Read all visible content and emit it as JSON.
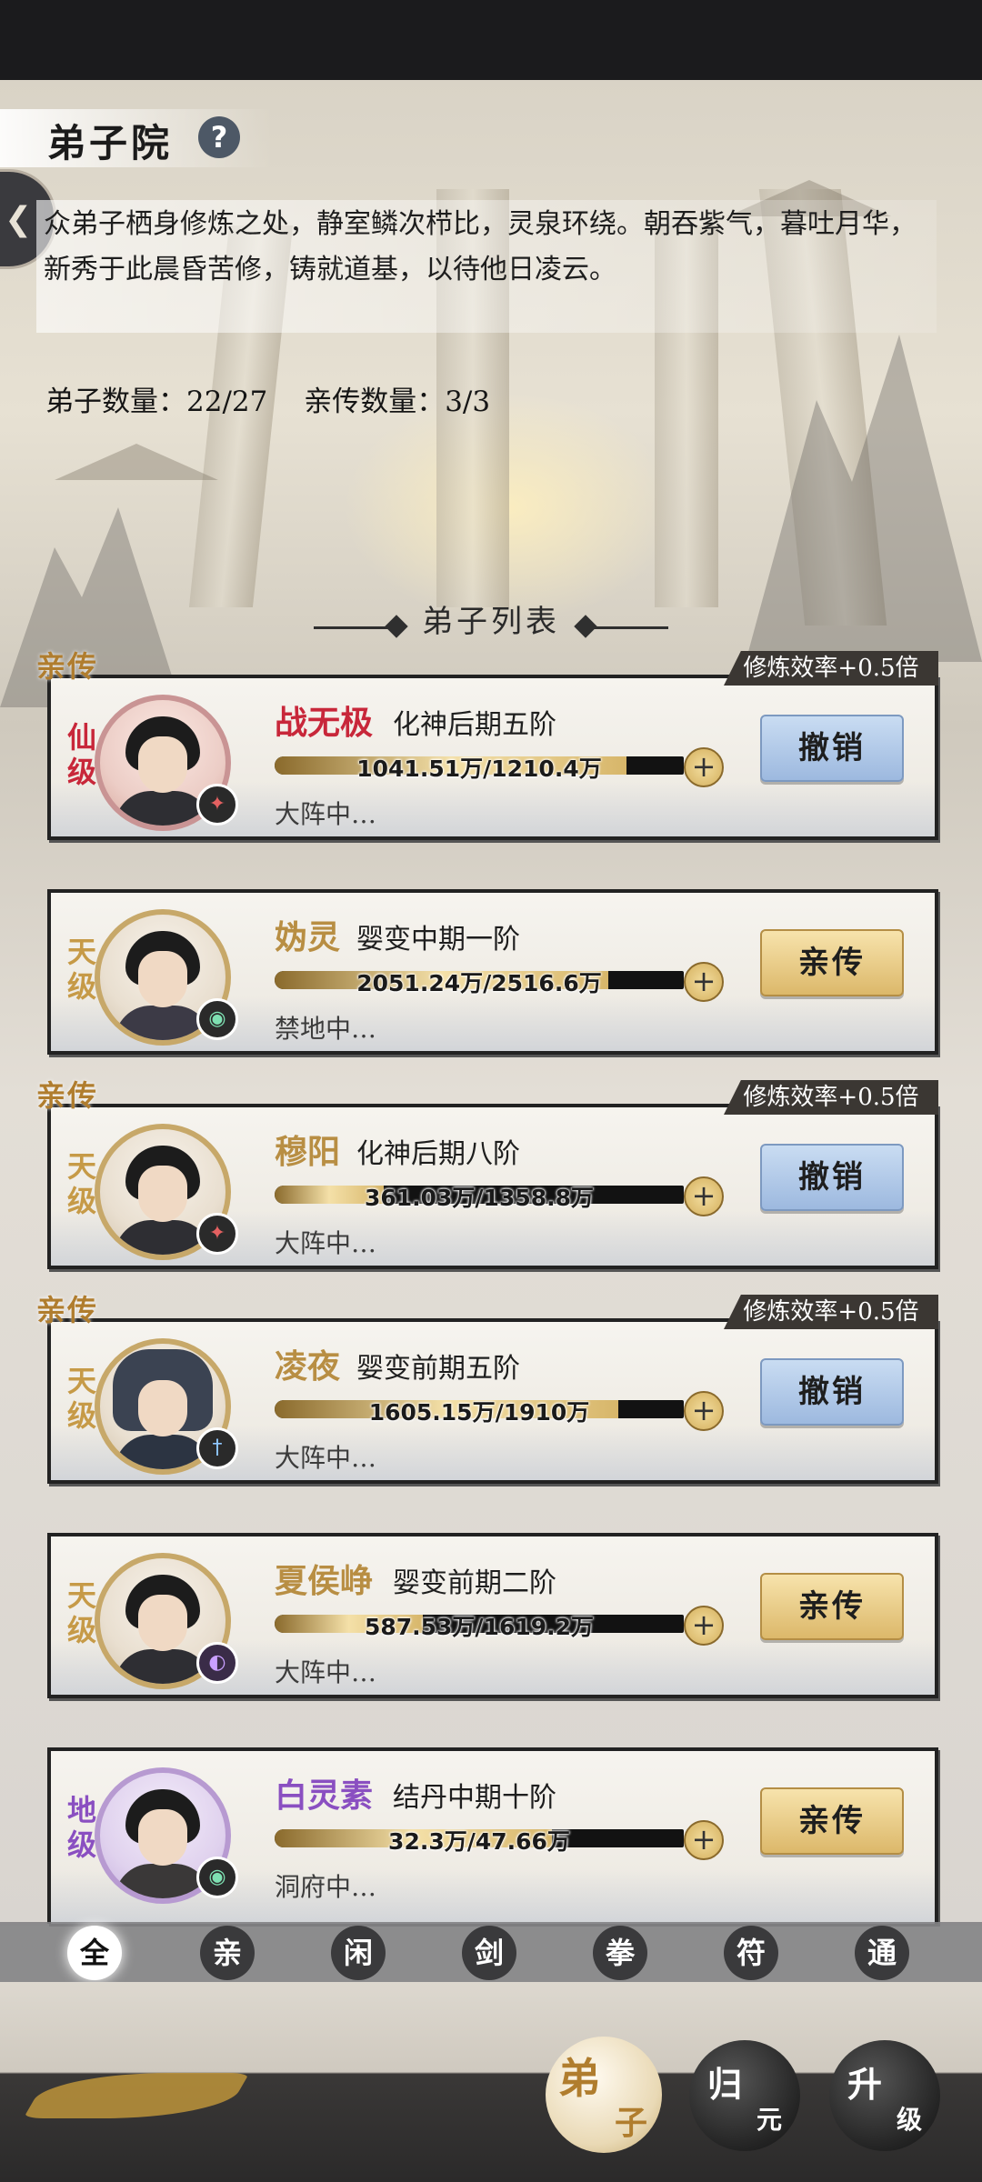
{
  "header": {
    "title": "弟子院",
    "help_icon": "?",
    "back_icon": "back-chevron"
  },
  "intro": {
    "text": "众弟子栖身修炼之处，静室鳞次栉比，灵泉环绕。朝吞紫气，暮吐月华，新秀于此晨昏苦修，铸就道基，以待他日凌云。"
  },
  "counts": {
    "disciples": "弟子数量：22/27",
    "inner": "亲传数量：3/3"
  },
  "list": {
    "title": "弟子列表"
  },
  "disciples": [
    {
      "name": "战无极",
      "realm": "化神后期五阶",
      "grade": "仙级",
      "progress": "1041.51万/1210.4万",
      "progress_ratio": 0.86,
      "status": "大阵中…",
      "action": "撤销",
      "inner": true,
      "inner_tag": "亲传",
      "bonus": "修炼效率+0.5倍",
      "element_icon": "fire-icon"
    },
    {
      "name": "妫灵",
      "realm": "婴变中期一阶",
      "grade": "天级",
      "progress": "2051.24万/2516.6万",
      "progress_ratio": 0.815,
      "status": "禁地中…",
      "action": "亲传",
      "inner": false,
      "element_icon": "wind-icon"
    },
    {
      "name": "穆阳",
      "realm": "化神后期八阶",
      "grade": "天级",
      "progress": "361.03万/1358.8万",
      "progress_ratio": 0.266,
      "status": "大阵中…",
      "action": "撤销",
      "inner": true,
      "inner_tag": "亲传",
      "bonus": "修炼效率+0.5倍",
      "element_icon": "fire-icon"
    },
    {
      "name": "凌夜",
      "realm": "婴变前期五阶",
      "grade": "天级",
      "progress": "1605.15万/1910万",
      "progress_ratio": 0.84,
      "status": "大阵中…",
      "action": "撤销",
      "inner": true,
      "inner_tag": "亲传",
      "bonus": "修炼效率+0.5倍",
      "element_icon": "sword-icon"
    },
    {
      "name": "夏侯峥",
      "realm": "婴变前期二阶",
      "grade": "天级",
      "progress": "587.53万/1619.2万",
      "progress_ratio": 0.363,
      "status": "大阵中…",
      "action": "亲传",
      "inner": false,
      "element_icon": "spirit-icon"
    },
    {
      "name": "白灵素",
      "realm": "结丹中期十阶",
      "grade": "地级",
      "progress": "32.3万/47.66万",
      "progress_ratio": 0.678,
      "status": "洞府中…",
      "action": "亲传",
      "inner": false,
      "element_icon": "wind-icon"
    }
  ],
  "filters": [
    "全",
    "亲",
    "闲",
    "剑",
    "拳",
    "符",
    "通"
  ],
  "filter_active": "全",
  "nav": [
    {
      "a": "弟",
      "b": "子"
    },
    {
      "a": "归",
      "b": "元"
    },
    {
      "a": "升",
      "b": "级"
    }
  ],
  "colors": {
    "grade_xian": "#c8273a",
    "grade_tian": "#c69a47",
    "grade_di": "#8a4fc1",
    "revoke_btn": "#9db9df",
    "promote_btn": "#dcb86a"
  }
}
